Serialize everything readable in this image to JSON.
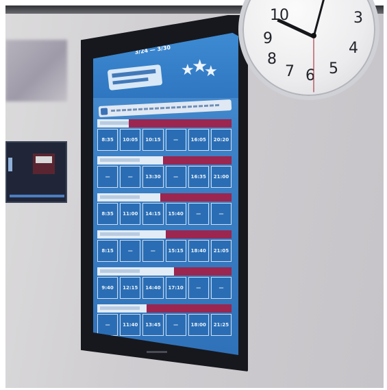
{
  "board": {
    "date_line": "3/24 — 3/30",
    "info_icon": "info-icon",
    "accent": "#9b264f",
    "screen_blue": "#3072b9"
  },
  "schedule": [
    {
      "times": [
        "8:35",
        "10:05",
        "10:15",
        "—",
        "16:05",
        "20:20"
      ]
    },
    {
      "times": [
        "—",
        "—",
        "13:30",
        "—",
        "16:35",
        "21:00"
      ]
    },
    {
      "times": [
        "8:35",
        "11:00",
        "14:15",
        "15:40",
        "—",
        "—"
      ]
    },
    {
      "times": [
        "8:15",
        "—",
        "—",
        "15:15",
        "18:40",
        "21:05"
      ]
    },
    {
      "times": [
        "9:40",
        "12:15",
        "14:40",
        "17:10",
        "—",
        "—"
      ]
    },
    {
      "times": [
        "—",
        "11:40",
        "13:45",
        "—",
        "18:00",
        "21:25"
      ]
    }
  ],
  "clock": {
    "numerals": [
      "10",
      "3",
      "9",
      "4",
      "8",
      "7",
      "6",
      "5"
    ]
  }
}
